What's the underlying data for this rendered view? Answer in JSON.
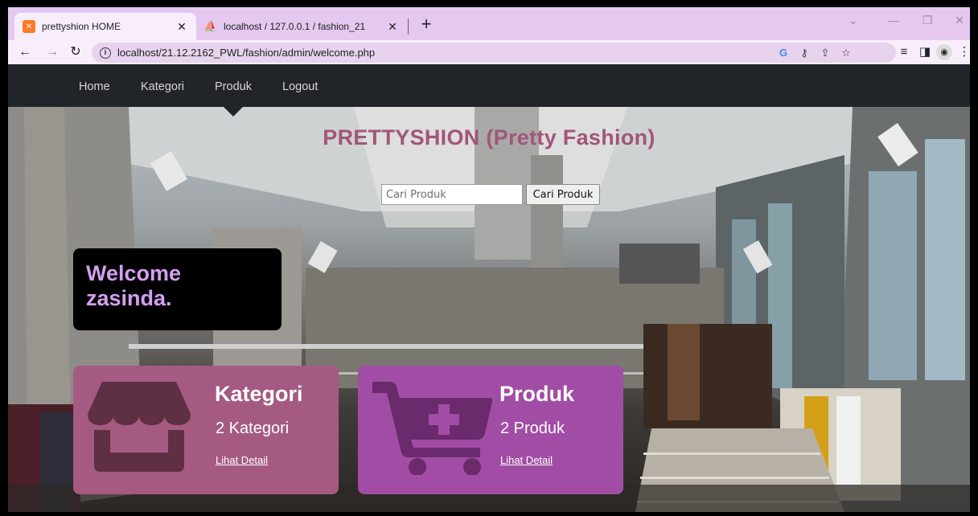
{
  "browser": {
    "tabs": [
      {
        "title": "prettyshion HOME",
        "favicon": "xampp-icon",
        "active": true
      },
      {
        "title": "localhost / 127.0.0.1 / fashion_21",
        "favicon": "phpmyadmin-icon",
        "active": false
      }
    ],
    "address": "localhost/21.12.2162_PWL/fashion/admin/welcome.php"
  },
  "navbar": {
    "items": [
      {
        "label": "Home"
      },
      {
        "label": "Kategori"
      },
      {
        "label": "Produk"
      },
      {
        "label": "Logout"
      }
    ],
    "active": "Produk"
  },
  "hero": {
    "title": "PRETTYSHION (Pretty Fashion)",
    "search": {
      "placeholder": "Cari Produk",
      "button_label": "Cari Produk"
    },
    "welcome": {
      "line1": "Welcome",
      "line2": "zasinda."
    }
  },
  "cards": [
    {
      "title": "Kategori",
      "count": "2 Kategori",
      "link": "Lihat Detail",
      "icon": "store-icon",
      "color": "#a55a82"
    },
    {
      "title": "Produk",
      "count": "2 Produk",
      "link": "Lihat Detail",
      "icon": "cart-plus-icon",
      "color": "#a24da5"
    }
  ],
  "colors": {
    "navbar": "#212529",
    "title": "#a2557a",
    "welcome_text": "#d49ff0",
    "tabstrip": "#e4c8ef"
  }
}
